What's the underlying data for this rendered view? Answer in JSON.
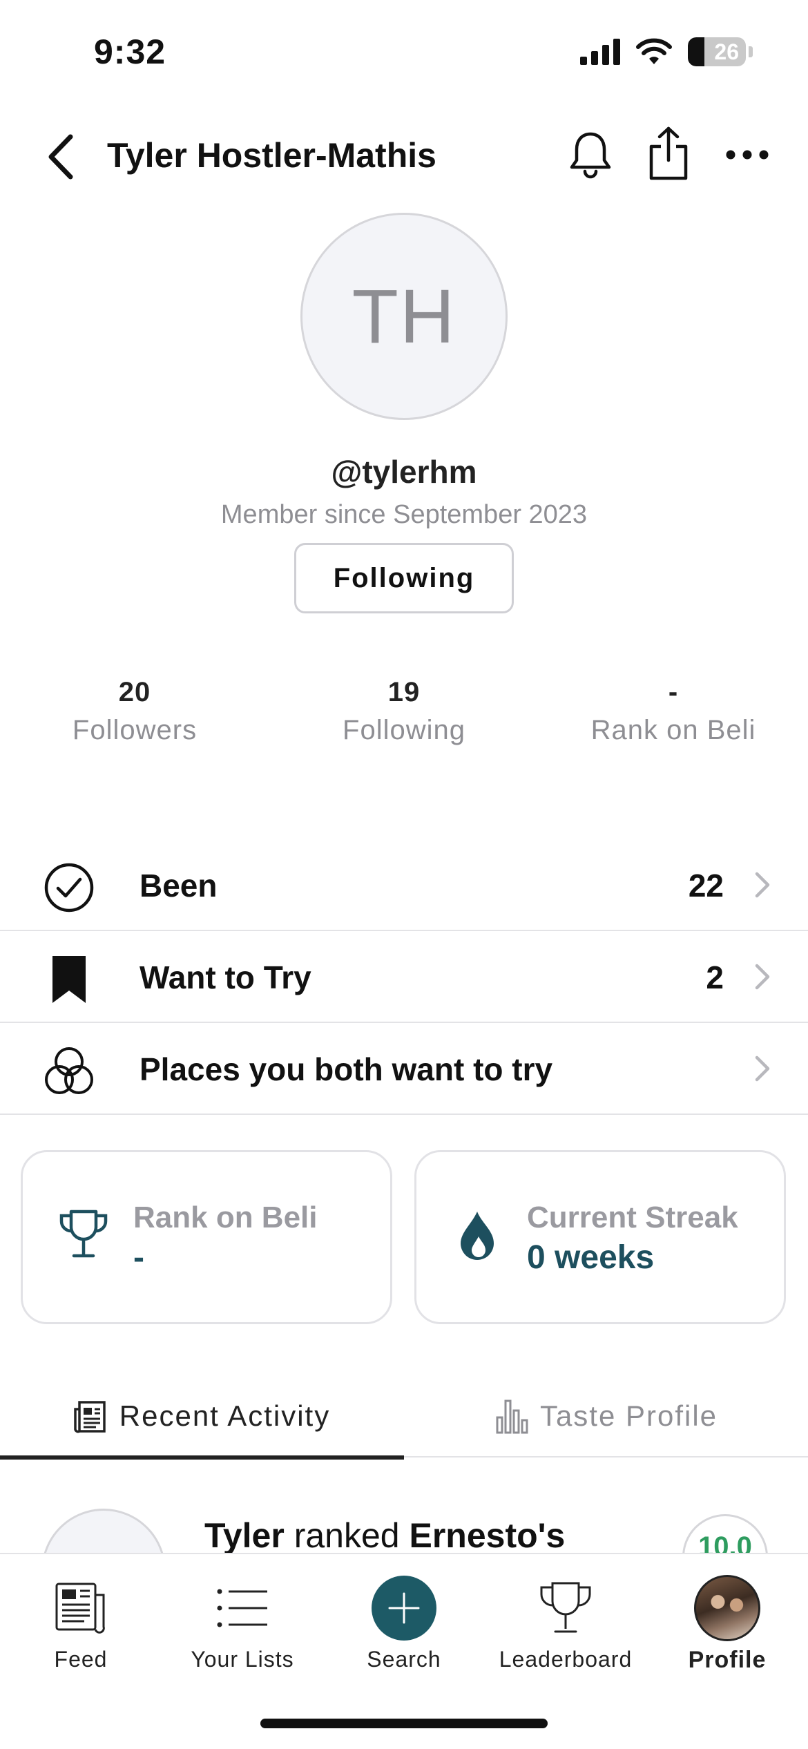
{
  "status_bar": {
    "time": "9:32",
    "battery": "26"
  },
  "header": {
    "title": "Tyler Hostler-Mathis"
  },
  "profile": {
    "initials": "TH",
    "handle": "@tylerhm",
    "member_since": "Member since September 2023",
    "follow_button": "Following"
  },
  "stats": [
    {
      "value": "20",
      "label": "Followers"
    },
    {
      "value": "19",
      "label": "Following"
    },
    {
      "value": "-",
      "label": "Rank on Beli"
    }
  ],
  "lists": [
    {
      "label": "Been",
      "count": "22",
      "icon": "check-circle-icon"
    },
    {
      "label": "Want to Try",
      "count": "2",
      "icon": "bookmark-icon"
    },
    {
      "label": "Places you both want to try",
      "count": "",
      "icon": "overlap-circles-icon"
    }
  ],
  "cards": {
    "rank": {
      "label": "Rank on Beli",
      "value": "-",
      "icon": "trophy-icon"
    },
    "streak": {
      "label": "Current Streak",
      "value": "0 weeks",
      "icon": "flame-icon"
    }
  },
  "tabs": {
    "activity": "Recent Activity",
    "taste": "Taste Profile"
  },
  "feed_preview": {
    "actor": "Tyler",
    "verb": "ranked",
    "place": "Ernesto's",
    "score": "10.0"
  },
  "bottom_nav": {
    "feed": "Feed",
    "lists": "Your Lists",
    "search": "Search",
    "leaderboard": "Leaderboard",
    "profile": "Profile"
  },
  "colors": {
    "accent": "#1d5a66",
    "accent_text": "#1d4f5e",
    "muted": "#8e8e93",
    "score_green": "#2e9c5f"
  }
}
